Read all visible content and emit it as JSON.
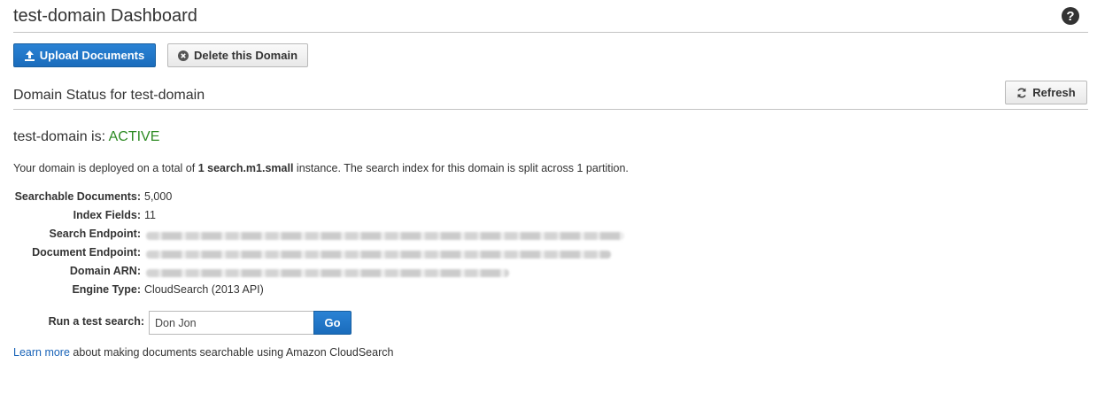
{
  "header": {
    "title": "test-domain Dashboard",
    "help_icon": "question-circle-icon"
  },
  "toolbar": {
    "upload_label": "Upload Documents",
    "upload_icon": "upload-icon",
    "delete_label": "Delete this Domain",
    "delete_icon": "close-circle-icon"
  },
  "status_section": {
    "title": "Domain Status for test-domain",
    "refresh_label": "Refresh",
    "refresh_icon": "refresh-icon",
    "status_prefix": "test-domain is: ",
    "status_value": "ACTIVE",
    "status_color": "#2e8b24",
    "description": {
      "part1": "Your domain is deployed on a total of ",
      "instance": "1 search.m1.small",
      "part2": " instance. The search index for this domain is split across ",
      "partitions": "1",
      "part3": " partition."
    }
  },
  "details": [
    {
      "label": "Searchable Documents:",
      "value": "5,000",
      "redacted": false
    },
    {
      "label": "Index Fields:",
      "value": "11",
      "redacted": false
    },
    {
      "label": "Search Endpoint:",
      "value": "",
      "redacted": true
    },
    {
      "label": "Document Endpoint:",
      "value": "",
      "redacted": true
    },
    {
      "label": "Domain ARN:",
      "value": "",
      "redacted": true
    },
    {
      "label": "Engine Type:",
      "value": "CloudSearch (2013 API)",
      "redacted": false
    }
  ],
  "test_search": {
    "label": "Run a test search:",
    "value": "Don Jon",
    "go_label": "Go"
  },
  "footer": {
    "link_text": "Learn more",
    "text": " about making documents searchable using Amazon CloudSearch"
  },
  "colors": {
    "primary": "#1f77c9",
    "link": "#1a64b8"
  }
}
